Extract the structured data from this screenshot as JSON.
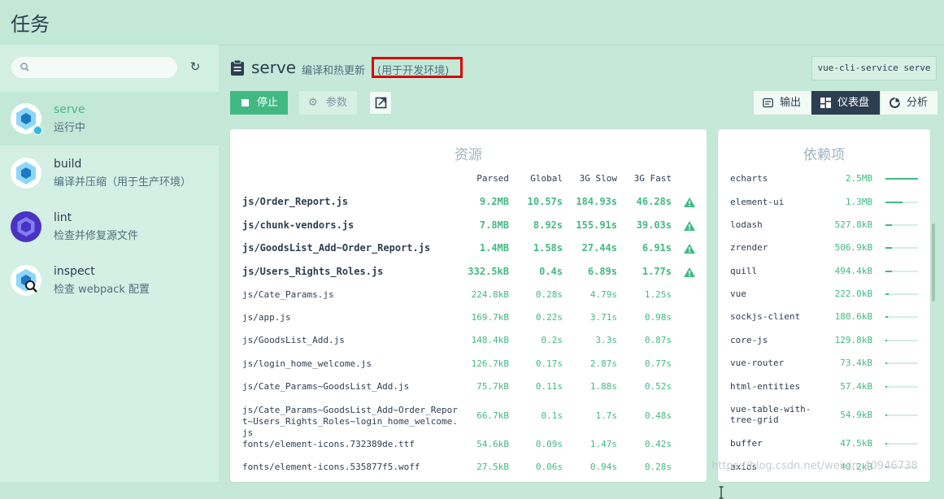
{
  "header": {
    "title": "任务"
  },
  "sidebar": {
    "search_placeholder": "",
    "tasks": [
      {
        "name": "serve",
        "desc": "运行中",
        "icon": "webpack-cube-icon",
        "active": true
      },
      {
        "name": "build",
        "desc": "编译并压缩（用于生产环境）",
        "icon": "webpack-cube-icon",
        "active": false
      },
      {
        "name": "lint",
        "desc": "检查并修复源文件",
        "icon": "eslint-hexagon-icon",
        "active": false
      },
      {
        "name": "inspect",
        "desc": "检查 webpack 配置",
        "icon": "webpack-inspect-icon",
        "active": false
      }
    ]
  },
  "main": {
    "task_title": "serve",
    "task_desc": "编译和热更新",
    "task_desc_highlight": "(用于开发环境)",
    "command": "vue-cli-service serve",
    "buttons": {
      "stop": "停止",
      "params": "参数"
    },
    "views": {
      "output": "输出",
      "dashboard": "仪表盘",
      "analyze": "分析"
    }
  },
  "assets": {
    "title": "资源",
    "columns": [
      "Parsed",
      "Global",
      "3G Slow",
      "3G Fast"
    ],
    "rows": [
      {
        "file": "js/Order_Report.js",
        "parsed": "9.2MB",
        "global": "10.57s",
        "slow": "184.93s",
        "fast": "46.28s",
        "big": true
      },
      {
        "file": "js/chunk-vendors.js",
        "parsed": "7.8MB",
        "global": "8.92s",
        "slow": "155.91s",
        "fast": "39.03s",
        "big": true
      },
      {
        "file": "js/GoodsList_Add~Order_Report.js",
        "parsed": "1.4MB",
        "global": "1.58s",
        "slow": "27.44s",
        "fast": "6.91s",
        "big": true
      },
      {
        "file": "js/Users_Rights_Roles.js",
        "parsed": "332.5kB",
        "global": "0.4s",
        "slow": "6.89s",
        "fast": "1.77s",
        "big": true
      },
      {
        "file": "js/Cate_Params.js",
        "parsed": "224.8kB",
        "global": "0.28s",
        "slow": "4.79s",
        "fast": "1.25s",
        "big": false
      },
      {
        "file": "js/app.js",
        "parsed": "169.7kB",
        "global": "0.22s",
        "slow": "3.71s",
        "fast": "0.98s",
        "big": false
      },
      {
        "file": "js/GoodsList_Add.js",
        "parsed": "148.4kB",
        "global": "0.2s",
        "slow": "3.3s",
        "fast": "0.87s",
        "big": false
      },
      {
        "file": "js/login_home_welcome.js",
        "parsed": "126.7kB",
        "global": "0.17s",
        "slow": "2.87s",
        "fast": "0.77s",
        "big": false
      },
      {
        "file": "js/Cate_Params~GoodsList_Add.js",
        "parsed": "75.7kB",
        "global": "0.11s",
        "slow": "1.88s",
        "fast": "0.52s",
        "big": false
      },
      {
        "file": "js/Cate_Params~GoodsList_Add~Order_Report~Users_Rights_Roles~login_home_welcome.js",
        "parsed": "66.7kB",
        "global": "0.1s",
        "slow": "1.7s",
        "fast": "0.48s",
        "big": false
      },
      {
        "file": "fonts/element-icons.732389de.ttf",
        "parsed": "54.6kB",
        "global": "0.09s",
        "slow": "1.47s",
        "fast": "0.42s",
        "big": false
      },
      {
        "file": "fonts/element-icons.535877f5.woff",
        "parsed": "27.5kB",
        "global": "0.06s",
        "slow": "0.94s",
        "fast": "0.28s",
        "big": false
      }
    ]
  },
  "deps": {
    "title": "依赖项",
    "rows": [
      {
        "name": "echarts",
        "size": "2.5MB",
        "share": 1.0
      },
      {
        "name": "element-ui",
        "size": "1.3MB",
        "share": 0.52
      },
      {
        "name": "lodash",
        "size": "527.8kB",
        "share": 0.21
      },
      {
        "name": "zrender",
        "size": "506.9kB",
        "share": 0.2
      },
      {
        "name": "quill",
        "size": "494.4kB",
        "share": 0.2
      },
      {
        "name": "vue",
        "size": "222.0kB",
        "share": 0.09
      },
      {
        "name": "sockjs-client",
        "size": "180.6kB",
        "share": 0.07
      },
      {
        "name": "core-js",
        "size": "129.8kB",
        "share": 0.05
      },
      {
        "name": "vue-router",
        "size": "73.4kB",
        "share": 0.03
      },
      {
        "name": "html-entities",
        "size": "57.4kB",
        "share": 0.02
      },
      {
        "name": "vue-table-with-tree-grid",
        "size": "54.9kB",
        "share": 0.02
      },
      {
        "name": "buffer",
        "size": "47.5kB",
        "share": 0.02
      },
      {
        "name": "axios",
        "size": "40.2kB",
        "share": 0.02
      }
    ]
  },
  "watermark": "https://blog.csdn.net/weixin_40946738",
  "colors": {
    "accent": "#42b983",
    "dark": "#2c3e50",
    "highlight": "#e00000",
    "warning": "#42b983"
  }
}
